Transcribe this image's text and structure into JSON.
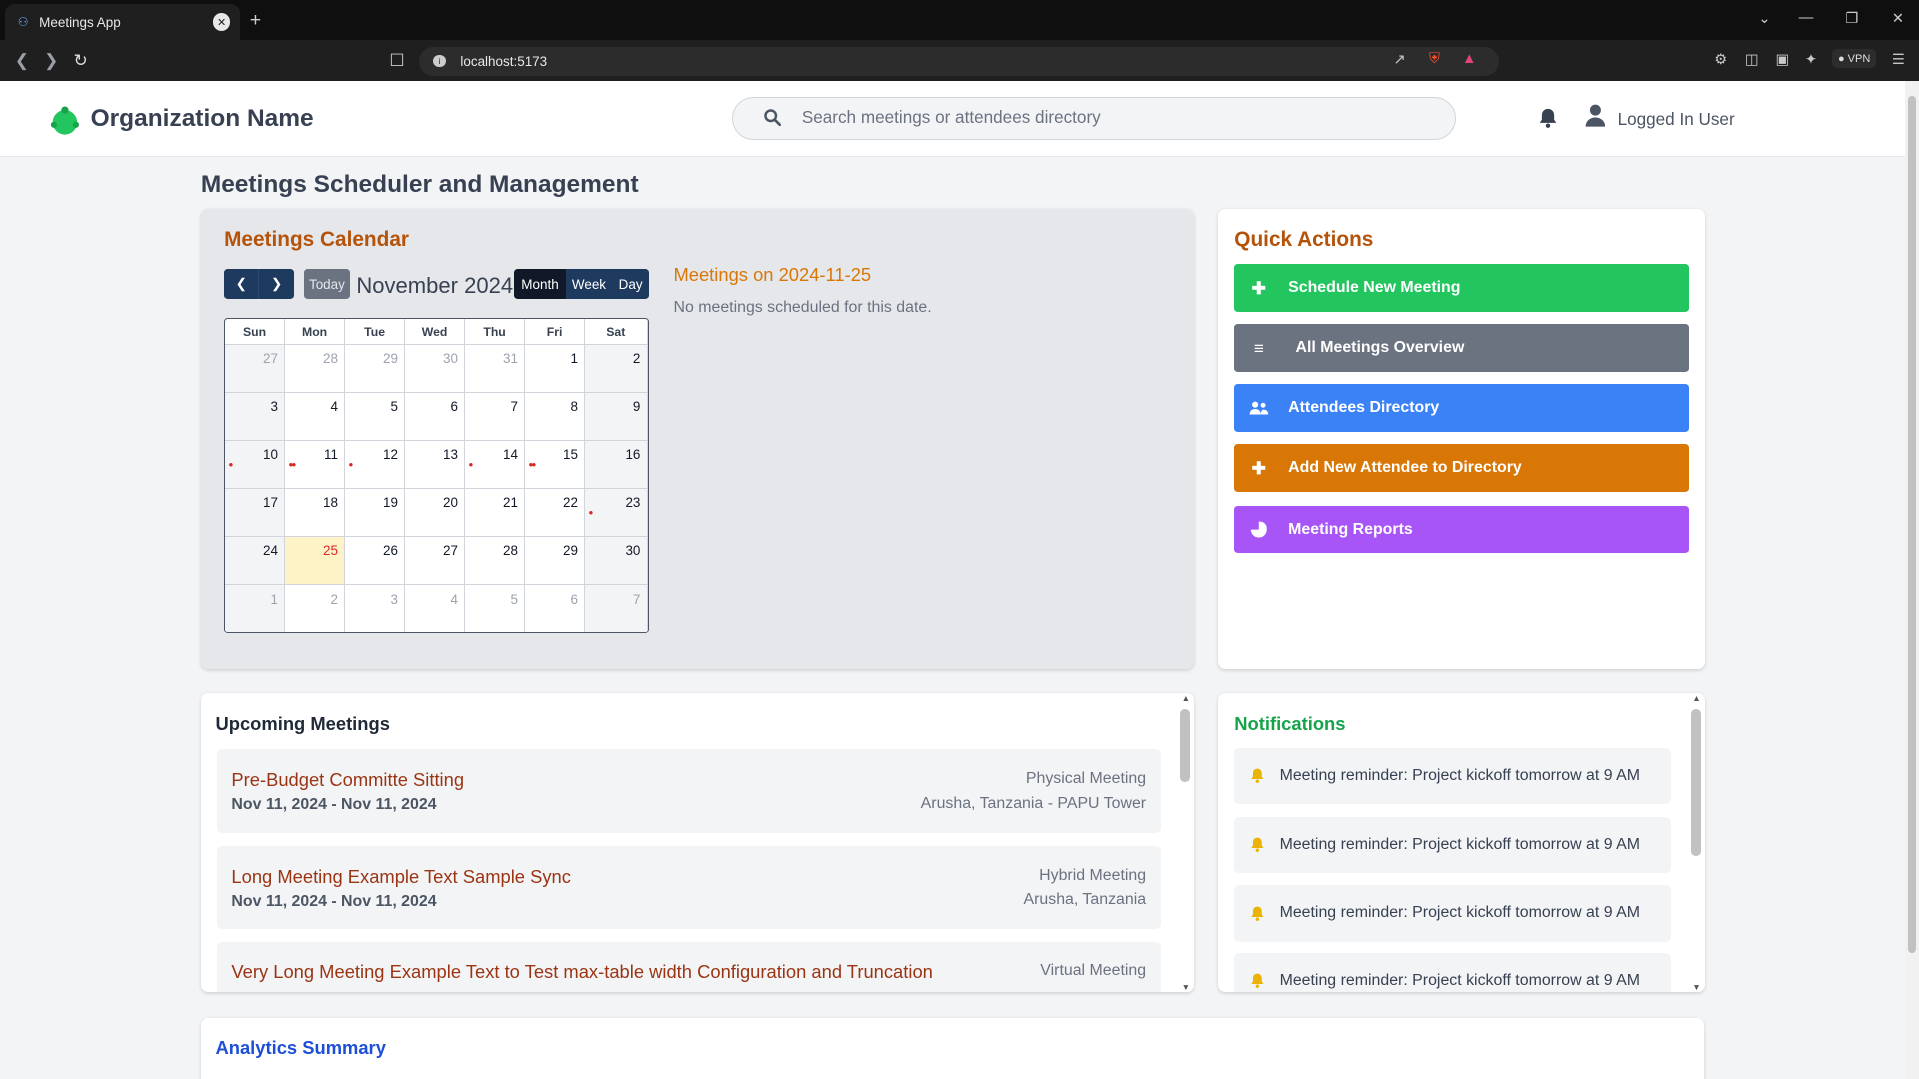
{
  "browser": {
    "tab_title": "Meetings App",
    "url": "localhost:5173",
    "vpn_label": "VPN"
  },
  "header": {
    "org_name": "Organization Name",
    "search_placeholder": "Search meetings or attendees directory",
    "user_name": "Logged In User"
  },
  "page_title": "Meetings Scheduler and Management",
  "calendar": {
    "title": "Meetings Calendar",
    "today_label": "Today",
    "month_label": "November 2024",
    "views": [
      "Month",
      "Week",
      "Day"
    ],
    "active_view": "Month",
    "weekdays": [
      "Sun",
      "Mon",
      "Tue",
      "Wed",
      "Thu",
      "Fri",
      "Sat"
    ],
    "weeks": [
      [
        "27",
        "28",
        "29",
        "30",
        "31",
        "1",
        "2"
      ],
      [
        "3",
        "4",
        "5",
        "6",
        "7",
        "8",
        "9"
      ],
      [
        "10",
        "11",
        "12",
        "13",
        "14",
        "15",
        "16"
      ],
      [
        "17",
        "18",
        "19",
        "20",
        "21",
        "22",
        "23"
      ],
      [
        "24",
        "25",
        "26",
        "27",
        "28",
        "29",
        "30"
      ],
      [
        "1",
        "2",
        "3",
        "4",
        "5",
        "6",
        "7"
      ]
    ],
    "selected_day": "25",
    "event_marks": {
      "10": 1,
      "11": 2,
      "12": 1,
      "14": 1,
      "15": 2,
      "23": 1
    },
    "selected_title": "Meetings on 2024-11-25",
    "selected_empty": "No meetings scheduled for this date."
  },
  "quick_actions": {
    "title": "Quick Actions",
    "buttons": [
      {
        "label": "Schedule New Meeting",
        "icon": "plus-icon",
        "color": "#22c55e"
      },
      {
        "label": "All Meetings Overview",
        "icon": "list-icon",
        "color": "#6b7280"
      },
      {
        "label": "Attendees Directory",
        "icon": "users-icon",
        "color": "#3b82f6"
      },
      {
        "label": "Add New Attendee to Directory",
        "icon": "plus-icon",
        "color": "#d97706"
      },
      {
        "label": "Meeting Reports",
        "icon": "pie-chart-icon",
        "color": "#a855f7"
      }
    ]
  },
  "upcoming": {
    "title": "Upcoming Meetings",
    "meetings": [
      {
        "title": "Pre-Budget Committe Sitting",
        "dates": "Nov 11, 2024 - Nov 11, 2024",
        "type": "Physical Meeting",
        "location": "Arusha, Tanzania - PAPU Tower"
      },
      {
        "title": "Long Meeting Example Text Sample Sync",
        "dates": "Nov 11, 2024 - Nov 11, 2024",
        "type": "Hybrid Meeting",
        "location": "Arusha, Tanzania"
      },
      {
        "title": "Very Long Meeting Example Text to Test max-table width Configuration and Truncation",
        "dates": "",
        "type": "Virtual Meeting",
        "location": ""
      }
    ]
  },
  "notifications": {
    "title": "Notifications",
    "items": [
      "Meeting reminder: Project kickoff tomorrow at 9 AM",
      "Meeting reminder: Project kickoff tomorrow at 9 AM",
      "Meeting reminder: Project kickoff tomorrow at 9 AM",
      "Meeting reminder: Project kickoff tomorrow at 9 AM"
    ]
  },
  "analytics": {
    "title": "Analytics Summary"
  },
  "colors": {
    "calendar_title": "#b45309",
    "quick_actions_title": "#b45309",
    "notifications_title": "#16a34a",
    "analytics_title": "#1d4ed8",
    "nav_button": "#1e3a5f"
  }
}
